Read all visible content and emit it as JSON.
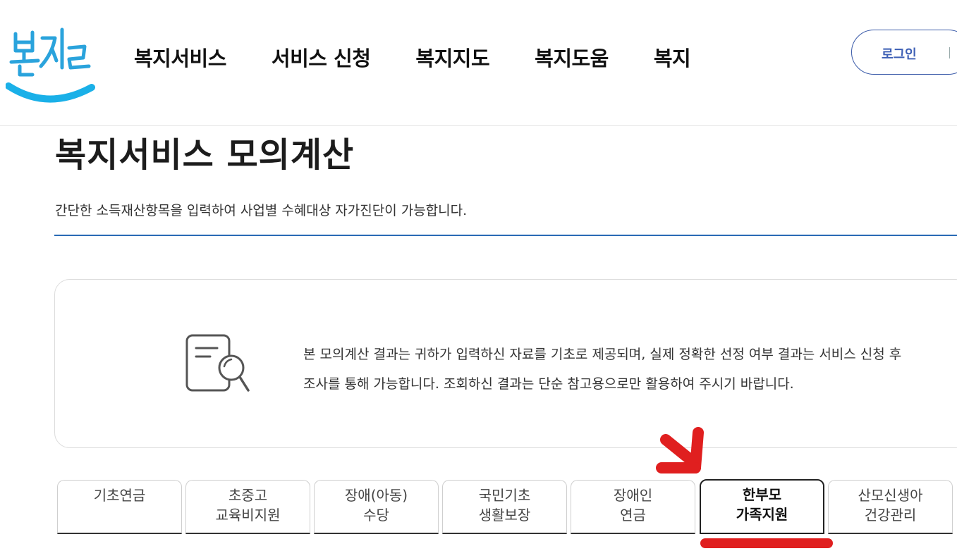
{
  "header": {
    "logo_text": "복지로",
    "nav": [
      "복지서비스",
      "서비스 신청",
      "복지지도",
      "복지도움",
      "복지"
    ],
    "login_label": "로그인"
  },
  "page": {
    "title": "복지서비스 모의계산",
    "description": "간단한 소득재산항목을 입력하여 사업별 수혜대상 자가진단이 가능합니다."
  },
  "notice": {
    "icon": "document-search-icon",
    "line1": "본 모의계산 결과는 귀하가 입력하신 자료를 기초로 제공되며, 실제 정확한 선정 여부 결과는 서비스 신청 후",
    "line2": "조사를 통해 가능합니다. 조회하신 결과는 단순 참고용으로만 활용하여 주시기 바랍니다."
  },
  "tabs": [
    {
      "line1": "기초연금",
      "line2": ""
    },
    {
      "line1": "초중고",
      "line2": "교육비지원"
    },
    {
      "line1": "장애(아동)",
      "line2": "수당"
    },
    {
      "line1": "국민기초",
      "line2": "생활보장"
    },
    {
      "line1": "장애인",
      "line2": "연금"
    },
    {
      "line1": "한부모",
      "line2": "가족지원"
    },
    {
      "line1": "산모신생아",
      "line2": "건강관리"
    }
  ],
  "active_tab": "한부모 가족지원",
  "colors": {
    "brand_blue": "#1ab0e8",
    "accent_rule": "#2a6bb5",
    "login_border": "#3b5ba9",
    "annotation_red": "#e01f1f"
  }
}
